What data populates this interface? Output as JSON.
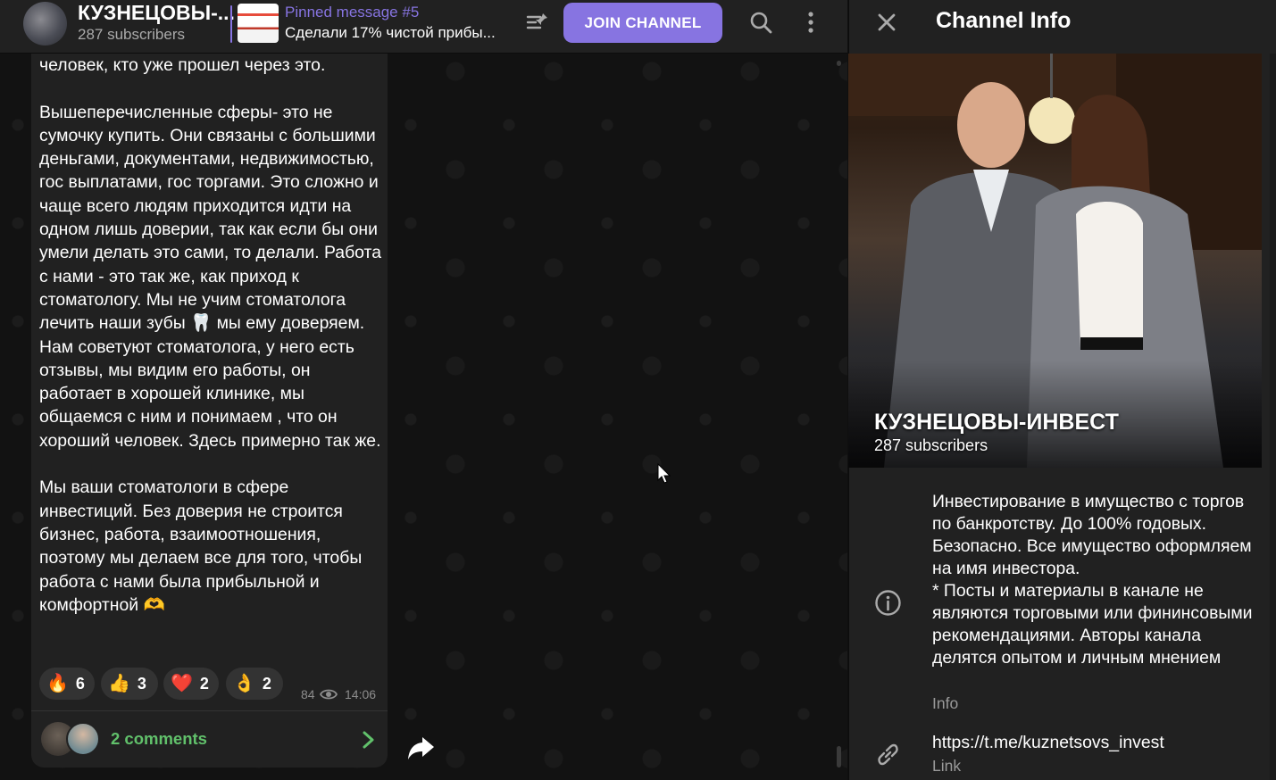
{
  "header": {
    "channel_title": "КУЗНЕЦОВЫ-...",
    "subscribers": "287 subscribers",
    "pinned_title": "Pinned message #5",
    "pinned_text": "Сделали 17% чистой прибы...",
    "join_label": "JOIN CHANNEL",
    "accent_color": "#8774e1"
  },
  "message": {
    "text": "человек, кто уже прошел через это.\n\nВышеперечисленные сферы- это не сумочку купить. Они связаны с большими деньгами, документами, недвижимостью, гос выплатами, гос торгами. Это сложно и чаще всего людям приходится идти на одном лишь доверии, так как если бы они умели делать это сами, то делали. Работа с нами - это так же, как приход к стоматологу. Мы не учим стоматолога лечить наши зубы 🦷 мы ему доверяем. Нам советуют стоматолога, у него есть отзывы, мы видим его работы, он работает в хорошей клинике, мы общаемся с ним и понимаем , что он хороший человек. Здесь примерно так же.\n\nМы ваши стоматологи в сфере инвестиций. Без доверия не строится бизнес, работа, взаимоотношения, поэтому мы делаем все для того, чтобы работа с нами была прибыльной и комфортной 🫶",
    "reactions": [
      {
        "emoji": "🔥",
        "count": "6"
      },
      {
        "emoji": "👍",
        "count": "3"
      },
      {
        "emoji": "❤️",
        "count": "2"
      },
      {
        "emoji": "👌",
        "count": "2"
      }
    ],
    "views": "84",
    "time": "14:06",
    "comments_label": "2 comments",
    "comments_color": "#61c16b"
  },
  "info_panel": {
    "title": "Channel Info",
    "channel_name": "КУЗНЕЦОВЫ-ИНВЕСТ",
    "subscribers": "287 subscribers",
    "description": "Инвестирование в имущество с торгов по банкротству. До 100% годовых. Безопасно. Все имущество оформляем на имя инвестора.\n* Посты и материалы в канале не являются торговыми или фининсовыми рекомендациями. Авторы канала делятся опытом и личным мнением",
    "description_label": "Info",
    "link": "https://t.me/kuznetsovs_invest",
    "link_label": "Link"
  },
  "icons": [
    "unpin-icon",
    "search-icon",
    "more-icon",
    "eye-icon",
    "chevron-right-icon",
    "forward-icon",
    "close-icon",
    "info-icon",
    "link-icon"
  ]
}
